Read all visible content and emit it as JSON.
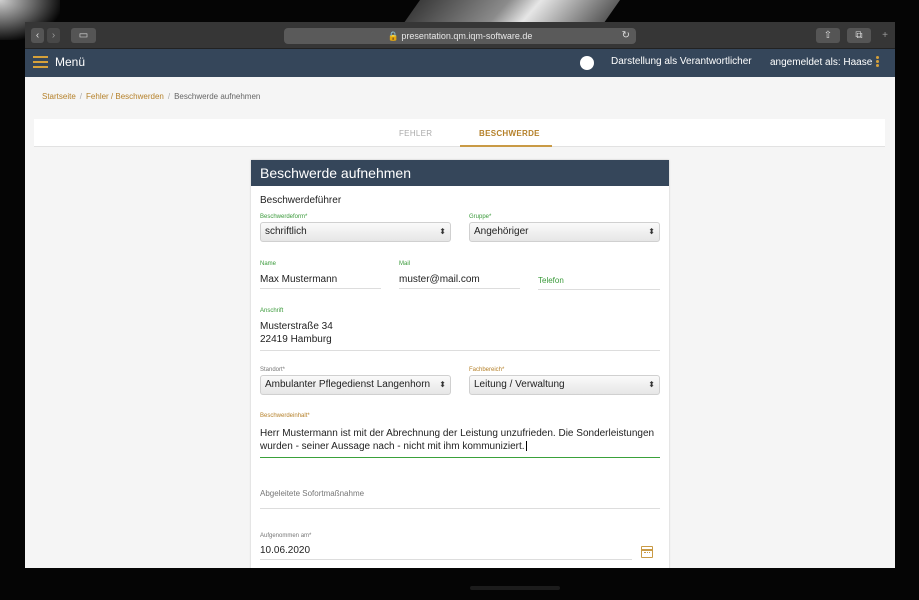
{
  "browser": {
    "url": "presentation.qm.iqm-software.de",
    "back_glyph": "‹",
    "forward_glyph": "›",
    "sidebar_glyph": "▭",
    "reload_glyph": "↻",
    "share_glyph": "⇧",
    "tabs_glyph": "⧉",
    "newtab_glyph": "+"
  },
  "header": {
    "menu_label": "Menü",
    "responsible_label": "Darstellung als Verantwortlicher",
    "user_label": "angemeldet als: Haase"
  },
  "breadcrumb": {
    "items": [
      "Startseite",
      "Fehler / Beschwerden",
      "Beschwerde aufnehmen"
    ],
    "separator": "/"
  },
  "tabs": [
    {
      "label": "FEHLER"
    },
    {
      "label": "BESCHWERDE"
    }
  ],
  "form": {
    "title": "Beschwerde aufnehmen",
    "section": "Beschwerdeführer",
    "beschwerdeform": {
      "label": "Beschwerdeform*",
      "value": "schriftlich"
    },
    "gruppe": {
      "label": "Gruppe*",
      "value": "Angehöriger"
    },
    "name": {
      "label": "Name",
      "value": "Max Mustermann"
    },
    "mail": {
      "label": "Mail",
      "value": "muster@mail.com"
    },
    "telefon": {
      "label": "Telefon"
    },
    "anschrift": {
      "label": "Anschrift",
      "line1": "Musterstraße 34",
      "line2": "22419 Hamburg"
    },
    "standort": {
      "label": "Standort*",
      "value": "Ambulanter Pflegedienst Langenhorn"
    },
    "fachbereich": {
      "label": "Fachbereich*",
      "value": "Leitung / Verwaltung"
    },
    "inhalt": {
      "label": "Beschwerdeinhalt*",
      "line1": "Herr Mustermann ist mit der Abrechnung der Leistung unzufrieden. Die Sonderleistungen",
      "line2": "wurden - seiner Aussage  nach - nicht  mit ihm kommuniziert."
    },
    "sofortmassnahme": {
      "label": "Abgeleitete Sofortmaßnahme"
    },
    "aufgenommen": {
      "label": "Aufgenommen am*",
      "value": "10.06.2020"
    },
    "select_arrow": "⬍"
  },
  "colors": {
    "header_bg": "#35465a",
    "accent": "#c99a45",
    "label_green": "#3a9a3a"
  }
}
